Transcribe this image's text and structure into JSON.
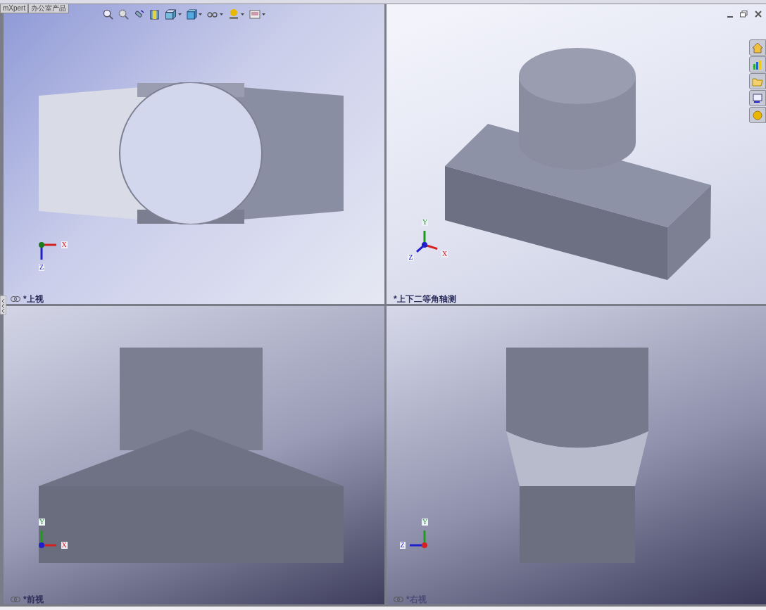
{
  "tabs": [
    {
      "label": "mXpert"
    },
    {
      "label": "办公室产品"
    }
  ],
  "viewports": [
    {
      "kind": "top",
      "label": "*上视",
      "axes": [
        "X",
        "Z"
      ]
    },
    {
      "kind": "iso",
      "label": "*上下二等角轴测",
      "axes": [
        "Y",
        "Z",
        "X"
      ]
    },
    {
      "kind": "front",
      "label": "*前视",
      "axes": [
        "Y",
        "X"
      ]
    },
    {
      "kind": "right",
      "label": "*右视",
      "axes": [
        "Y",
        "Z"
      ]
    }
  ]
}
